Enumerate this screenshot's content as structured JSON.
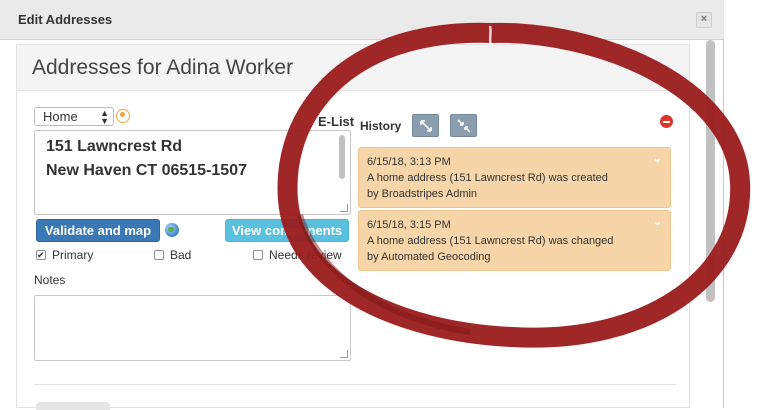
{
  "dialog": {
    "title": "Edit Addresses",
    "close_symbol": "×"
  },
  "panel": {
    "title": "Addresses for Adina Worker"
  },
  "address": {
    "type_select": "Home",
    "elist_label": "E-List",
    "line1": "151 Lawncrest Rd",
    "line2": "New Haven CT 06515-1507",
    "validate_button": "Validate and map",
    "components_button": "View components",
    "checkboxes": [
      {
        "label": "Primary",
        "checked": true
      },
      {
        "label": "Bad",
        "checked": false
      },
      {
        "label": "Needs review",
        "checked": false
      }
    ],
    "notes_label": "Notes",
    "notes_value": ""
  },
  "history": {
    "label": "History",
    "entries": [
      {
        "timestamp": "6/15/18, 3:13 PM",
        "message": "A home address (151 Lawncrest Rd) was created",
        "author": "by Broadstripes Admin"
      },
      {
        "timestamp": "6/15/18, 3:15 PM",
        "message": "A home address (151 Lawncrest Rd) was changed",
        "author": "by Automated Geocoding"
      }
    ]
  },
  "colors": {
    "annotation_circle": "#9b1b1b",
    "history_card": "#f6d5a8",
    "validate_button": "#3a79b5",
    "components_button": "#5bc0de"
  },
  "icons": [
    "close-icon",
    "person-icon",
    "globe-icon",
    "expand-icon",
    "collapse-icon",
    "remove-icon",
    "chevron-down-icon"
  ]
}
